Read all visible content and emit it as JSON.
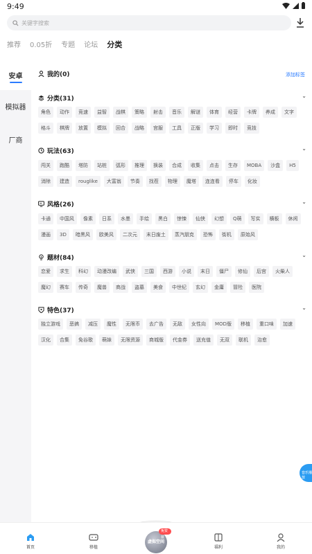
{
  "status": {
    "time": "9:49"
  },
  "search": {
    "placeholder": "关键字搜索"
  },
  "top_tabs": [
    "推荐",
    "0.05折",
    "专题",
    "论坛",
    "分类"
  ],
  "sidebar": {
    "items": [
      "安卓",
      "模拟器",
      "厂商"
    ]
  },
  "sections": {
    "mine": {
      "title": "我的(0)",
      "action": "添加标签"
    },
    "category": {
      "title": "分类(31)",
      "tags": [
        "角色",
        "动作",
        "竞速",
        "益智",
        "战棋",
        "策略",
        "射击",
        "音乐",
        "解谜",
        "体育",
        "经营",
        "卡牌",
        "养成",
        "文字",
        "格斗",
        "棋牌",
        "放置",
        "模拟",
        "回合",
        "战略",
        "宫服",
        "工具",
        "正版",
        "学习",
        "即时",
        "竞技"
      ]
    },
    "gameplay": {
      "title": "玩法(63)",
      "tags": [
        "闯关",
        "跑酷",
        "塔防",
        "站桩",
        "弧形",
        "推理",
        "换装",
        "合成",
        "收集",
        "点击",
        "生存",
        "MOBA",
        "沙盒",
        "H5",
        "消除",
        "建造",
        "rouglike",
        "大富翁",
        "节奏",
        "找茬",
        "物理",
        "魔塔",
        "连连看",
        "停车",
        "化妆"
      ]
    },
    "style": {
      "title": "风格(26)",
      "tags": [
        "卡通",
        "中国风",
        "像素",
        "日系",
        "水墨",
        "手绘",
        "黑白",
        "惊悚",
        "仙侠",
        "幻想",
        "Q萌",
        "写实",
        "横板",
        "休闲",
        "漫画",
        "3D",
        "暗黑风",
        "欧美风",
        "二次元",
        "末日废土",
        "蒸汽朋克",
        "恐怖",
        "街机",
        "原始风"
      ]
    },
    "theme": {
      "title": "题材(84)",
      "tags": [
        "恋爱",
        "求生",
        "科幻",
        "动漫改编",
        "武侠",
        "三国",
        "西游",
        "小说",
        "末日",
        "僵尸",
        "修仙",
        "后宫",
        "火柴人",
        "魔幻",
        "赛车",
        "传奇",
        "魔兽",
        "商战",
        "盗墓",
        "美食",
        "中世纪",
        "玄幻",
        "金庸",
        "冒险",
        "医院"
      ]
    },
    "feature": {
      "title": "特色(37)",
      "tags": [
        "独立游戏",
        "恶搞",
        "减压",
        "魔性",
        "无限币",
        "去广告",
        "无敌",
        "女性向",
        "MOD版",
        "移植",
        "重口味",
        "加速",
        "汉化",
        "合集",
        "免谷歌",
        "萌妹",
        "无限资源",
        "商城版",
        "代金券",
        "送充值",
        "无双",
        "联机",
        "治愈"
      ]
    }
  },
  "float_button": {
    "label": "音乐播放"
  },
  "bottom_nav": {
    "items": [
      "首页",
      "移植",
      "福利",
      "我的"
    ],
    "center_label": "虚拟空间",
    "center_badge": "免安装"
  },
  "colors": {
    "accent": "#2b7cff",
    "tag_bg": "#f3f3f5",
    "sidebar_bg": "#f5f5f7"
  }
}
